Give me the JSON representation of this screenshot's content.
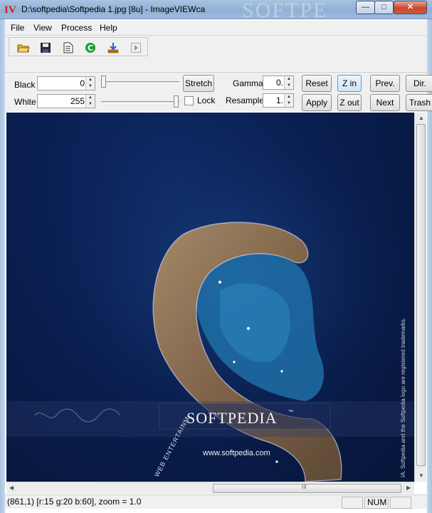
{
  "window": {
    "icon_glyph": "IV",
    "title": "D:\\softpedia\\Softpedia 1.jpg [8u] - ImageVIEWca",
    "title_watermark": "SOFTPE",
    "minimize_glyph": "—",
    "maximize_glyph": "□",
    "close_glyph": "✕"
  },
  "menu": {
    "items": [
      {
        "label": "File"
      },
      {
        "label": "View"
      },
      {
        "label": "Process"
      },
      {
        "label": "Help"
      }
    ]
  },
  "toolbar": {
    "buttons": [
      {
        "icon": "open-folder-icon"
      },
      {
        "icon": "save-disk-icon"
      },
      {
        "icon": "document-icon"
      },
      {
        "icon": "refresh-c-icon"
      },
      {
        "icon": "download-arrow-icon"
      },
      {
        "icon": "next-frame-icon"
      }
    ]
  },
  "controls": {
    "black_label": "Black",
    "black_value": "0",
    "white_label": "White",
    "white_value": "255",
    "stretch_label": "Stretch",
    "lock_label": "Lock",
    "lock_checked": false,
    "gamma_label": "Gamma",
    "gamma_value": "0.",
    "resample_label": "Resample",
    "resample_value": "1.",
    "reset_label": "Reset",
    "apply_label": "Apply",
    "zin_label": "Z in",
    "zout_label": "Z out",
    "prev_label": "Prev.",
    "next_label": "Next",
    "dir_label": "Dir.",
    "trash_label": "Trash",
    "black_slider_level": 0,
    "white_slider_level": 1
  },
  "image": {
    "brand": "SOFTPEDIA",
    "trademark": "™",
    "url": "www.softpedia.com",
    "vertical_notice": "IA.  Softpedia and the Softpedia logo are registered trademarks.",
    "curved_text": "WEB  ENTERTAINM",
    "colors": {
      "ocean": "#0a1f52",
      "island": "#8a6a48",
      "lagoon": "#1f6fa6"
    }
  },
  "scrollbars": {
    "grip_glyph": "III"
  },
  "status": {
    "info": "(861,1) [r:15 g:20 b:60], zoom = 1.0",
    "panel2": "",
    "num": "NUM",
    "panel4": ""
  }
}
